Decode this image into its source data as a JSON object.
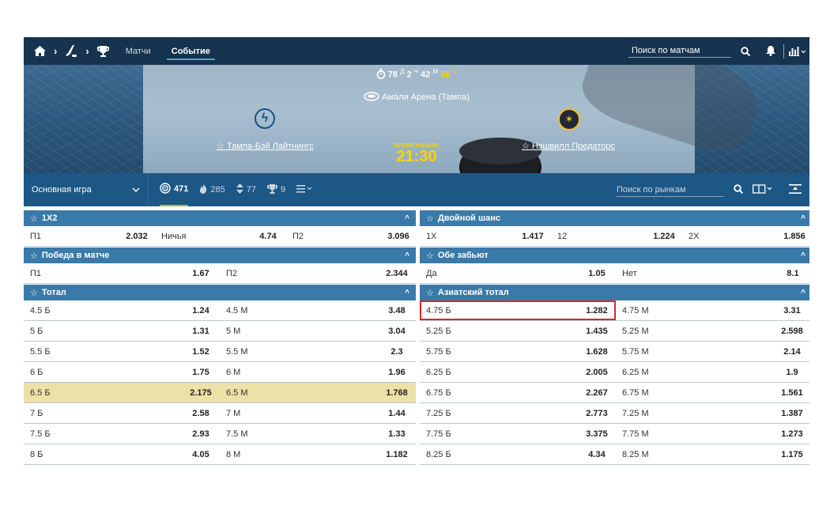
{
  "nav": {
    "tab_matches": "Матчи",
    "tab_event": "Событие",
    "search_placeholder": "Поиск по матчам"
  },
  "hero": {
    "timer": {
      "days": "78",
      "days_unit": "Д",
      "hours": "2",
      "hours_unit": "Ч",
      "minutes": "42",
      "minutes_unit": "М",
      "seconds": "56",
      "seconds_unit": "С"
    },
    "venue": "Амали Арена (Тампа)",
    "start_label": "ВРЕМЯ НАЧАЛА",
    "start_time": "21:30",
    "home_team": "Тампа-Бэй Лайтнингс",
    "away_team": "Нэшвилл Предаторс"
  },
  "marketbar": {
    "selected_market": "Основная игра",
    "stat1": "471",
    "stat2": "285",
    "stat3": "77",
    "stat4": "9",
    "search_placeholder": "Поиск по рынкам"
  },
  "left": {
    "m1x2": {
      "title": "1X2",
      "row": {
        "p1_label": "П1",
        "p1_odd": "2.032",
        "draw_label": "Ничья",
        "draw_odd": "4.74",
        "p2_label": "П2",
        "p2_odd": "3.096"
      }
    },
    "win": {
      "title": "Победа в матче",
      "row": {
        "p1_label": "П1",
        "p1_odd": "1.67",
        "p2_label": "П2",
        "p2_odd": "2.344"
      }
    },
    "total": {
      "title": "Тотал",
      "rows": [
        {
          "over": "4.5 Б",
          "over_odd": "1.24",
          "under": "4.5 М",
          "under_odd": "3.48"
        },
        {
          "over": "5 Б",
          "over_odd": "1.31",
          "under": "5 М",
          "under_odd": "3.04"
        },
        {
          "over": "5.5 Б",
          "over_odd": "1.52",
          "under": "5.5 М",
          "under_odd": "2.3"
        },
        {
          "over": "6 Б",
          "over_odd": "1.75",
          "under": "6 М",
          "under_odd": "1.96"
        },
        {
          "over": "6.5 Б",
          "over_odd": "2.175",
          "under": "6.5 М",
          "under_odd": "1.768"
        },
        {
          "over": "7 Б",
          "over_odd": "2.58",
          "under": "7 М",
          "under_odd": "1.44"
        },
        {
          "over": "7.5 Б",
          "over_odd": "2.93",
          "under": "7.5 М",
          "under_odd": "1.33"
        },
        {
          "over": "8 Б",
          "over_odd": "4.05",
          "under": "8 М",
          "under_odd": "1.182"
        }
      ]
    }
  },
  "right": {
    "double": {
      "title": "Двойной шанс",
      "row": {
        "a_label": "1X",
        "a_odd": "1.417",
        "b_label": "12",
        "b_odd": "1.224",
        "c_label": "2X",
        "c_odd": "1.856"
      }
    },
    "btts": {
      "title": "Обе забьют",
      "row": {
        "yes_label": "Да",
        "yes_odd": "1.05",
        "no_label": "Нет",
        "no_odd": "8.1"
      }
    },
    "asian": {
      "title": "Азиатский тотал",
      "rows": [
        {
          "over": "4.75 Б",
          "over_odd": "1.282",
          "under": "4.75 М",
          "under_odd": "3.31"
        },
        {
          "over": "5.25 Б",
          "over_odd": "1.435",
          "under": "5.25 М",
          "under_odd": "2.598"
        },
        {
          "over": "5.75 Б",
          "over_odd": "1.628",
          "under": "5.75 М",
          "under_odd": "2.14"
        },
        {
          "over": "6.25 Б",
          "over_odd": "2.005",
          "under": "6.25 М",
          "under_odd": "1.9"
        },
        {
          "over": "6.75 Б",
          "over_odd": "2.267",
          "under": "6.75 М",
          "under_odd": "1.561"
        },
        {
          "over": "7.25 Б",
          "over_odd": "2.773",
          "under": "7.25 М",
          "under_odd": "1.387"
        },
        {
          "over": "7.75 Б",
          "over_odd": "3.375",
          "under": "7.75 М",
          "under_odd": "1.273"
        },
        {
          "over": "8.25 Б",
          "over_odd": "4.34",
          "under": "8.25 М",
          "under_odd": "1.175"
        }
      ]
    }
  },
  "colors": {
    "nav_bg": "#16334f",
    "market_bar_bg": "#1d5785",
    "market_header_bg": "#3a7aa8",
    "selected_row_bg": "#ece1a7",
    "highlight_border": "#d72828",
    "accent_yellow": "#ffd400"
  }
}
